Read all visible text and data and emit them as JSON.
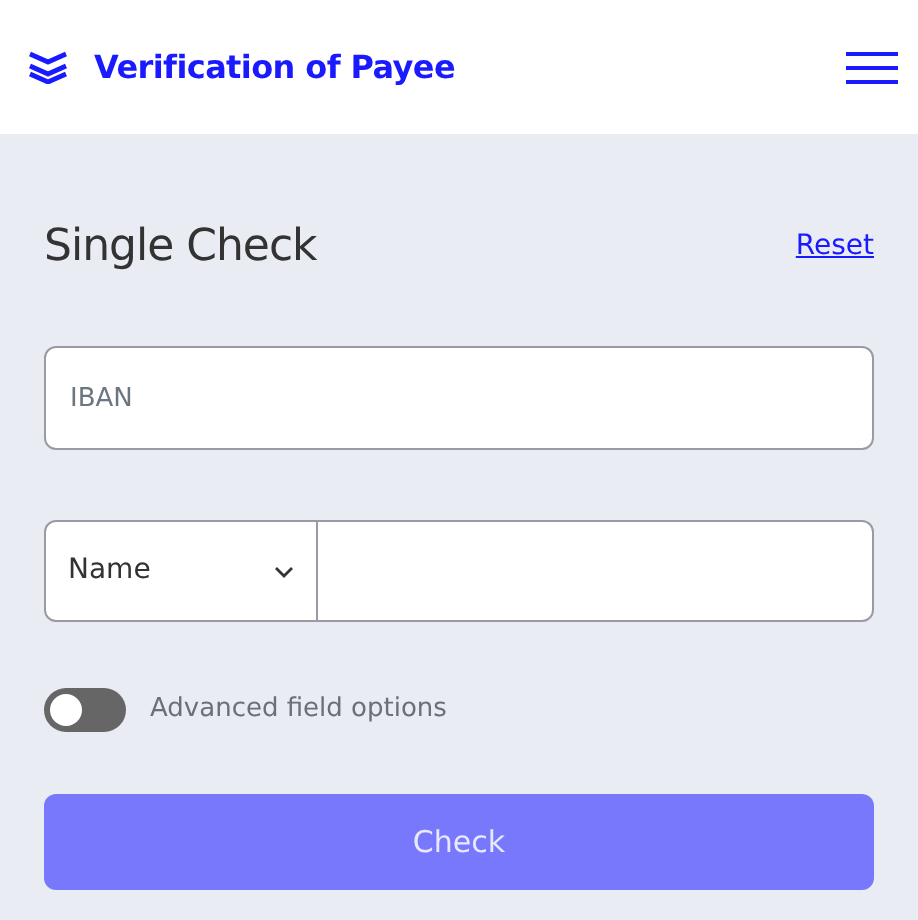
{
  "header": {
    "title": "Verification of Payee"
  },
  "form": {
    "title": "Single Check",
    "reset_link": "Reset",
    "iban_field": {
      "placeholder": "IBAN"
    },
    "name_select": {
      "value": "Name"
    },
    "advanced_toggle": {
      "label": "Advanced field options",
      "on": false
    },
    "submit_button": {
      "label": "Check",
      "disabled": true
    }
  }
}
